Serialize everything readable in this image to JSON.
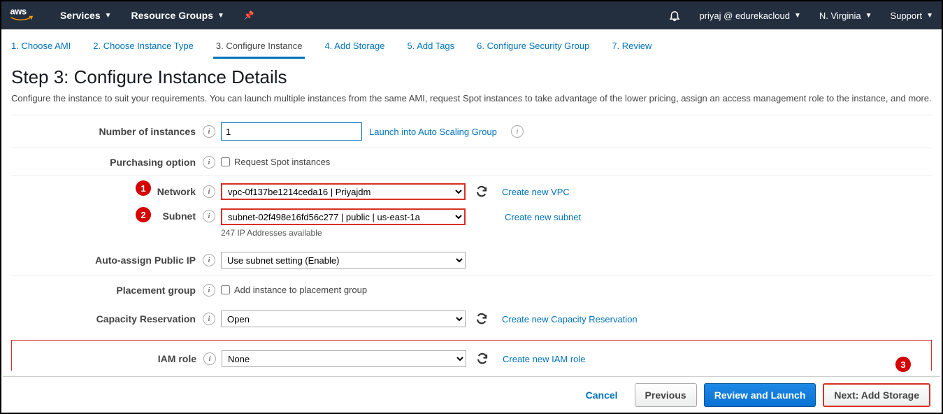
{
  "nav": {
    "logo": "aws",
    "services": "Services",
    "resource_groups": "Resource Groups",
    "account": "priyaj @ edurekacloud",
    "region": "N. Virginia",
    "support": "Support"
  },
  "wizard": {
    "s1": "1. Choose AMI",
    "s2": "2. Choose Instance Type",
    "s3": "3. Configure Instance",
    "s4": "4. Add Storage",
    "s5": "5. Add Tags",
    "s6": "6. Configure Security Group",
    "s7": "7. Review"
  },
  "page": {
    "title": "Step 3: Configure Instance Details",
    "desc": "Configure the instance to suit your requirements. You can launch multiple instances from the same AMI, request Spot instances to take advantage of the lower pricing, assign an access management role to the instance, and more."
  },
  "labels": {
    "num_instances": "Number of instances",
    "purchasing": "Purchasing option",
    "network": "Network",
    "subnet": "Subnet",
    "auto_ip": "Auto-assign Public IP",
    "placement": "Placement group",
    "capacity": "Capacity Reservation",
    "iam": "IAM role"
  },
  "values": {
    "num_instances": "1",
    "spot_label": "Request Spot instances",
    "network": "vpc-0f137be1214ceda16 | Priyajdm",
    "subnet": "subnet-02f498e16fd56c277 | public | us-east-1a",
    "subnet_help": "247 IP Addresses available",
    "auto_ip": "Use subnet setting (Enable)",
    "placement_label": "Add instance to placement group",
    "capacity": "Open",
    "iam": "None"
  },
  "links": {
    "asg": "Launch into Auto Scaling Group",
    "new_vpc": "Create new VPC",
    "new_subnet": "Create new subnet",
    "new_cap": "Create new Capacity Reservation",
    "new_iam": "Create new IAM role"
  },
  "footer": {
    "cancel": "Cancel",
    "previous": "Previous",
    "review": "Review and Launch",
    "next": "Next: Add Storage"
  },
  "anno": {
    "a1": "1",
    "a2": "2",
    "a3": "3"
  }
}
